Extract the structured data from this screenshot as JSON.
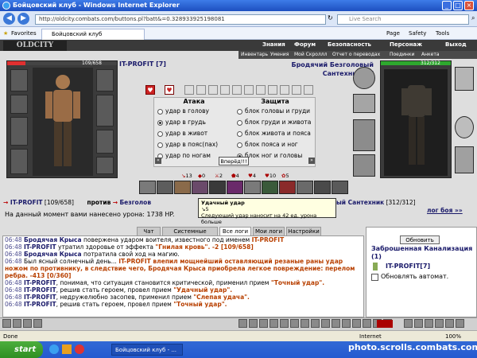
{
  "window": {
    "title": "Бойцовский клуб - Windows Internet Explorer",
    "url": "http://oldcity.combats.com/buttons.pl?batt&=0.328933925198081",
    "search_placeholder": "Live Search",
    "favorites_label": "Favorites",
    "tab_title": "Бойцовский клуб",
    "toolbar": [
      "Page",
      "Safety",
      "Tools"
    ],
    "controls": {
      "minimize": "_",
      "maximize": "□",
      "close": "×"
    }
  },
  "game": {
    "logo": "OLDCITY",
    "menu_top": [
      "Знания",
      "Форум",
      "Безопасность",
      "Персонаж",
      "Выход"
    ],
    "menu_sub": [
      "Инвентарь",
      "Умения",
      "Мой Скроллл",
      "Отчет о переводах",
      "Поединки",
      "Анкета"
    ],
    "player": {
      "name": "IT-PROFIT [7]",
      "hp": "109/658",
      "hp_fraction": 0.17
    },
    "enemy": {
      "name": "Бродячий Безголовый Сантехник [5]",
      "hp": "312/312",
      "hp_fraction": 1.0
    },
    "attack_header": "Атака",
    "defense_header": "Защита",
    "attacks": [
      "удар в голову",
      "удар в грудь",
      "удар в живот",
      "удар в пояс(пах)",
      "удар по ногам"
    ],
    "defenses": [
      "блок головы и груди",
      "блок груди и живота",
      "блок живота и пояса",
      "блок пояса и ног",
      "блок ног и головы"
    ],
    "selected_attack_index": 1,
    "selected_defense_index": 4,
    "forward_button": "Вперёд!!!",
    "counters": [
      "13",
      "0",
      "2",
      "4",
      "4",
      "10",
      "5"
    ],
    "vs_line": {
      "player": "IT-PROFIT",
      "player_hp": "[109/658]",
      "vs": "против",
      "enemy_short": "Безголов",
      "enemy_tail": "ый Сантехник",
      "enemy_hp": "[312/312]"
    },
    "damage_line": "На данный момент вами нанесено урона: 1738 HP.",
    "fight_log_link": "лог боя »»",
    "tooltip": {
      "title": "Удачный удар",
      "line2": "5",
      "line3": "Следующий удар наносит на 42 ед. урона больше"
    },
    "log_tabs": [
      "Чат",
      "Системные сообщения",
      "Все логи",
      "Мои логи",
      "Настройки"
    ],
    "log_lines": [
      {
        "time": "06:48",
        "name": "Бродячая Крыса",
        "text": " повержена ударом воителя, известного под именем ",
        "tail": "IT-PROFIT"
      },
      {
        "time": "06:48",
        "name": "IT-PROFIT",
        "text": " утратил здоровье от эффекта ",
        "tail": "\"Гнилая кровь\". -2 [109/658]"
      },
      {
        "time": "06:48",
        "name": "Бродячая Крыса",
        "text": " потратила свой ход на магию.",
        "tail": ""
      },
      {
        "time": "06:48",
        "name": "",
        "text": " Был ясный солнечный день... ",
        "tail": "IT-PROFIT влепил мощнейший оставляющий резаные раны удар ножом по противнику, в следствие чего, Бродячая Крыса приобрела легкое повреждение: перелом ребра. -413 [0/360]"
      },
      {
        "time": "06:48",
        "name": "IT-PROFIT",
        "text": ", понимая, что ситуация становится критической, применил прием ",
        "tail": "\"Точный удар\"."
      },
      {
        "time": "06:48",
        "name": "IT-PROFIT",
        "text": ", решив стать героем, провел прием ",
        "tail": "\"Удачный удар\"."
      },
      {
        "time": "06:48",
        "name": "IT-PROFIT",
        "text": ", недружелюбно засопев, применил прием ",
        "tail": "\"Слепая удача\"."
      },
      {
        "time": "06:48",
        "name": "IT-PROFIT",
        "text": ", решив стать героем, провел прием ",
        "tail": "\"Точный удар\"."
      }
    ],
    "side": {
      "refresh_button": "Обновить",
      "location": "Заброшенная Канализация (1)",
      "user": "IT-PROFIT[7]",
      "auto_label": "Обновлять автомат."
    }
  },
  "statusbar": {
    "left": "Done",
    "zone": "Internet",
    "zoom": "100%"
  },
  "taskbar": {
    "start": "start",
    "task": "Бойцовский клуб - ...",
    "watermark": "photo.scrolls.combats.com"
  }
}
